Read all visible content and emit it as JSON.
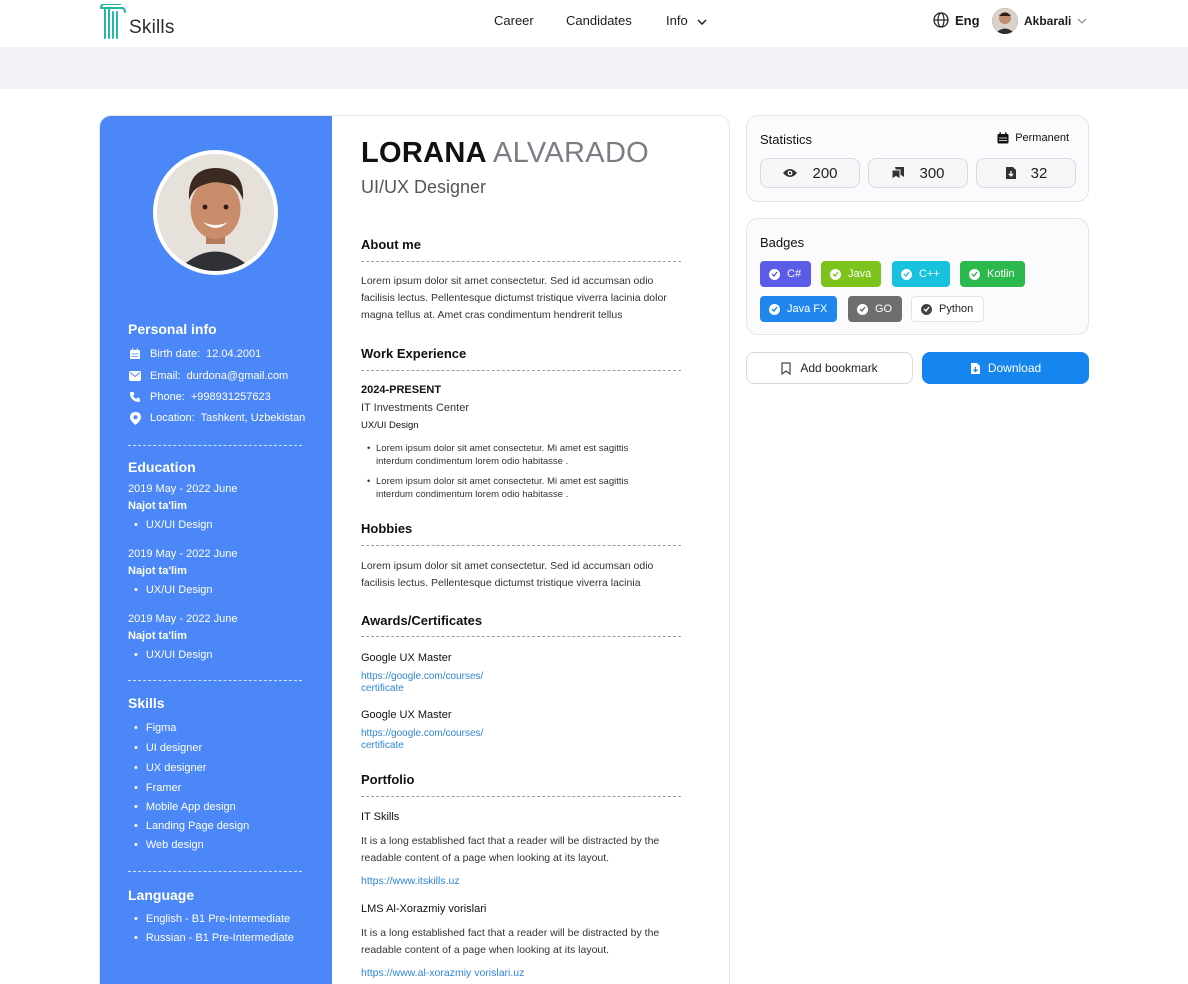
{
  "header": {
    "logo_text": "Skills",
    "nav": [
      {
        "label": "Career"
      },
      {
        "label": "Candidates"
      },
      {
        "label": "Info"
      }
    ],
    "language": "Eng",
    "user_name": "Akbarali"
  },
  "resume": {
    "first_name": "LORANA",
    "last_name": "ALVARADO",
    "job_title": "UI/UX Designer",
    "personal_info": {
      "title": "Personal info",
      "birth_label": "Birth date:",
      "birth_value": "12.04.2001",
      "email_label": "Email:",
      "email_value": "durdona@gmail.com",
      "phone_label": "Phone:",
      "phone_value": "+998931257623",
      "location_label": "Location:",
      "location_value": "Tashkent, Uzbekistan"
    },
    "education": {
      "title": "Education",
      "items": [
        {
          "dates": "2019 May - 2022 June",
          "school": "Najot ta'lim",
          "course": "UX/UI Design"
        },
        {
          "dates": "2019 May - 2022 June",
          "school": "Najot ta'lim",
          "course": "UX/UI Design"
        },
        {
          "dates": "2019 May - 2022 June",
          "school": "Najot ta'lim",
          "course": "UX/UI Design"
        }
      ]
    },
    "skills": {
      "title": "Skills",
      "items": [
        "Figma",
        "UI designer",
        "UX designer",
        "Framer",
        "Mobile App design",
        "Landing Page design",
        "Web design"
      ]
    },
    "language": {
      "title": "Language",
      "items": [
        "English - B1 Pre-Intermediate",
        "Russian - B1 Pre-Intermediate"
      ]
    },
    "about": {
      "title": "About me",
      "text": "Lorem ipsum dolor sit amet consectetur. Sed id accumsan odio facilisis lectus. Pellentesque dictumst tristique viverra lacinia dolor magna tellus at. Amet cras condimentum hendrerit tellus"
    },
    "work": {
      "title": "Work Experience",
      "period": "2024-PRESENT",
      "company": "IT Investments Center",
      "role": "UX/UI Design",
      "bullets": [
        "Lorem ipsum dolor sit amet consectetur. Mi amet est sagittis interdum condimentum lorem odio habitasse .",
        "Lorem ipsum dolor sit amet consectetur. Mi amet est sagittis interdum condimentum lorem odio habitasse ."
      ]
    },
    "hobbies": {
      "title": "Hobbies",
      "text": "Lorem ipsum dolor sit amet consectetur. Sed id accumsan odio facilisis lectus. Pellentesque dictumst tristique viverra lacinia"
    },
    "awards": {
      "title": "Awards/Certificates",
      "items": [
        {
          "name": "Google UX Master",
          "link_line1": "https://google.com/courses/",
          "link_line2": "certificate"
        },
        {
          "name": "Google UX Master",
          "link_line1": "https://google.com/courses/",
          "link_line2": "certificate"
        }
      ]
    },
    "portfolio": {
      "title": "Portfolio",
      "items": [
        {
          "name": "IT Skills",
          "text": "It is a long established fact that a reader will be distracted by the readable content of a page when looking at its layout.",
          "link": "https://www.itskills.uz"
        },
        {
          "name": "LMS Al-Xorazmiy vorislari",
          "text": "It is a long established fact that a reader will be distracted by the readable content of a page when looking at its layout.",
          "link": "https://www.al-xorazmiy vorislari.uz"
        }
      ]
    }
  },
  "statistics": {
    "title": "Statistics",
    "type_label": "Permanent",
    "views": "200",
    "saves": "300",
    "downloads": "32"
  },
  "badges": {
    "title": "Badges",
    "items": [
      {
        "label": "C#",
        "color": "#5a5ce8"
      },
      {
        "label": "Java",
        "color": "#7cc31b"
      },
      {
        "label": "C++",
        "color": "#18c2dd"
      },
      {
        "label": "Kotlin",
        "color": "#2bb84c"
      },
      {
        "label": "Java FX",
        "color": "#1f86ee"
      },
      {
        "label": "GO",
        "color": "#6e6e6e"
      },
      {
        "label": "Python",
        "color": "#ffffff"
      }
    ]
  },
  "actions": {
    "bookmark_label": "Add bookmark",
    "download_label": "Download"
  },
  "icons": [
    "logo-icon",
    "chevron-down-icon",
    "globe-icon",
    "avatar",
    "calendar-icon",
    "mail-icon",
    "phone-icon",
    "location-pin-icon",
    "eye-icon",
    "book-icon",
    "download-file-icon",
    "check-icon",
    "bookmark-icon"
  ]
}
